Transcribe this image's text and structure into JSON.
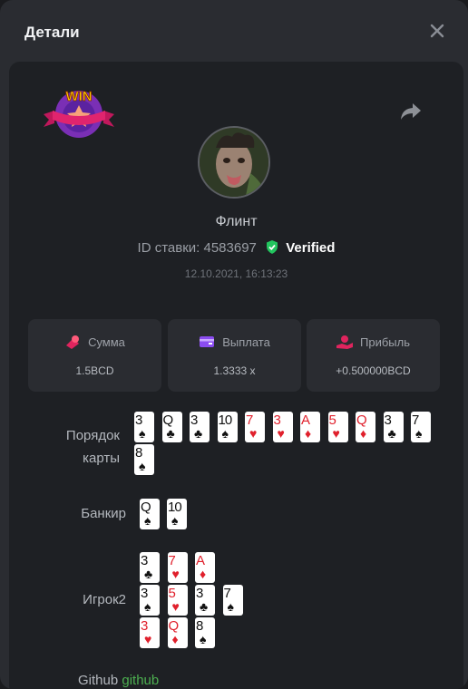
{
  "modal": {
    "title": "Детали"
  },
  "badge": {
    "text": "WIN"
  },
  "user": {
    "name": "Флинт",
    "bet_id_label": "ID ставки:",
    "bet_id": "4583697",
    "verified_label": "Verified",
    "datetime": "12.10.2021, 16:13:23"
  },
  "stats": [
    {
      "label": "Сумма",
      "value": "1.5BCD",
      "icon": "coins-icon"
    },
    {
      "label": "Выплата",
      "value": "1.3333 x",
      "icon": "wallet-icon"
    },
    {
      "label": "Прибыль",
      "value": "+0.500000BCD",
      "icon": "profit-hand-icon"
    }
  ],
  "rows": {
    "card_order": {
      "label_line1": "Порядок",
      "label_line2": "карты",
      "cards": [
        {
          "rank": "3",
          "suit": "♠"
        },
        {
          "rank": "Q",
          "suit": "♣"
        },
        {
          "rank": "3",
          "suit": "♣"
        },
        {
          "rank": "10",
          "suit": "♠"
        },
        {
          "rank": "7",
          "suit": "♥"
        },
        {
          "rank": "3",
          "suit": "♥"
        },
        {
          "rank": "A",
          "suit": "♦"
        },
        {
          "rank": "5",
          "suit": "♥"
        },
        {
          "rank": "Q",
          "suit": "♦"
        },
        {
          "rank": "3",
          "suit": "♣"
        },
        {
          "rank": "7",
          "suit": "♠"
        },
        {
          "rank": "8",
          "suit": "♠"
        }
      ]
    },
    "banker": {
      "label": "Банкир",
      "cards": [
        {
          "rank": "Q",
          "suit": "♠"
        },
        {
          "rank": "10",
          "suit": "♠"
        }
      ]
    },
    "player2": {
      "label": "Игрок2",
      "hands": [
        [
          {
            "rank": "3",
            "suit": "♣"
          },
          {
            "rank": "7",
            "suit": "♥"
          },
          {
            "rank": "A",
            "suit": "♦"
          }
        ],
        [
          {
            "rank": "3",
            "suit": "♠"
          },
          {
            "rank": "5",
            "suit": "♥"
          },
          {
            "rank": "3",
            "suit": "♣"
          },
          {
            "rank": "7",
            "suit": "♠"
          }
        ],
        [
          {
            "rank": "3",
            "suit": "♥"
          },
          {
            "rank": "Q",
            "suit": "♦"
          },
          {
            "rank": "8",
            "suit": "♠"
          }
        ]
      ]
    }
  },
  "footer": {
    "text_a": "Github",
    "text_b": "github"
  },
  "colors": {
    "red_suit": "#e0202c",
    "black_suit": "#111111",
    "verified_green": "#22c55e"
  }
}
